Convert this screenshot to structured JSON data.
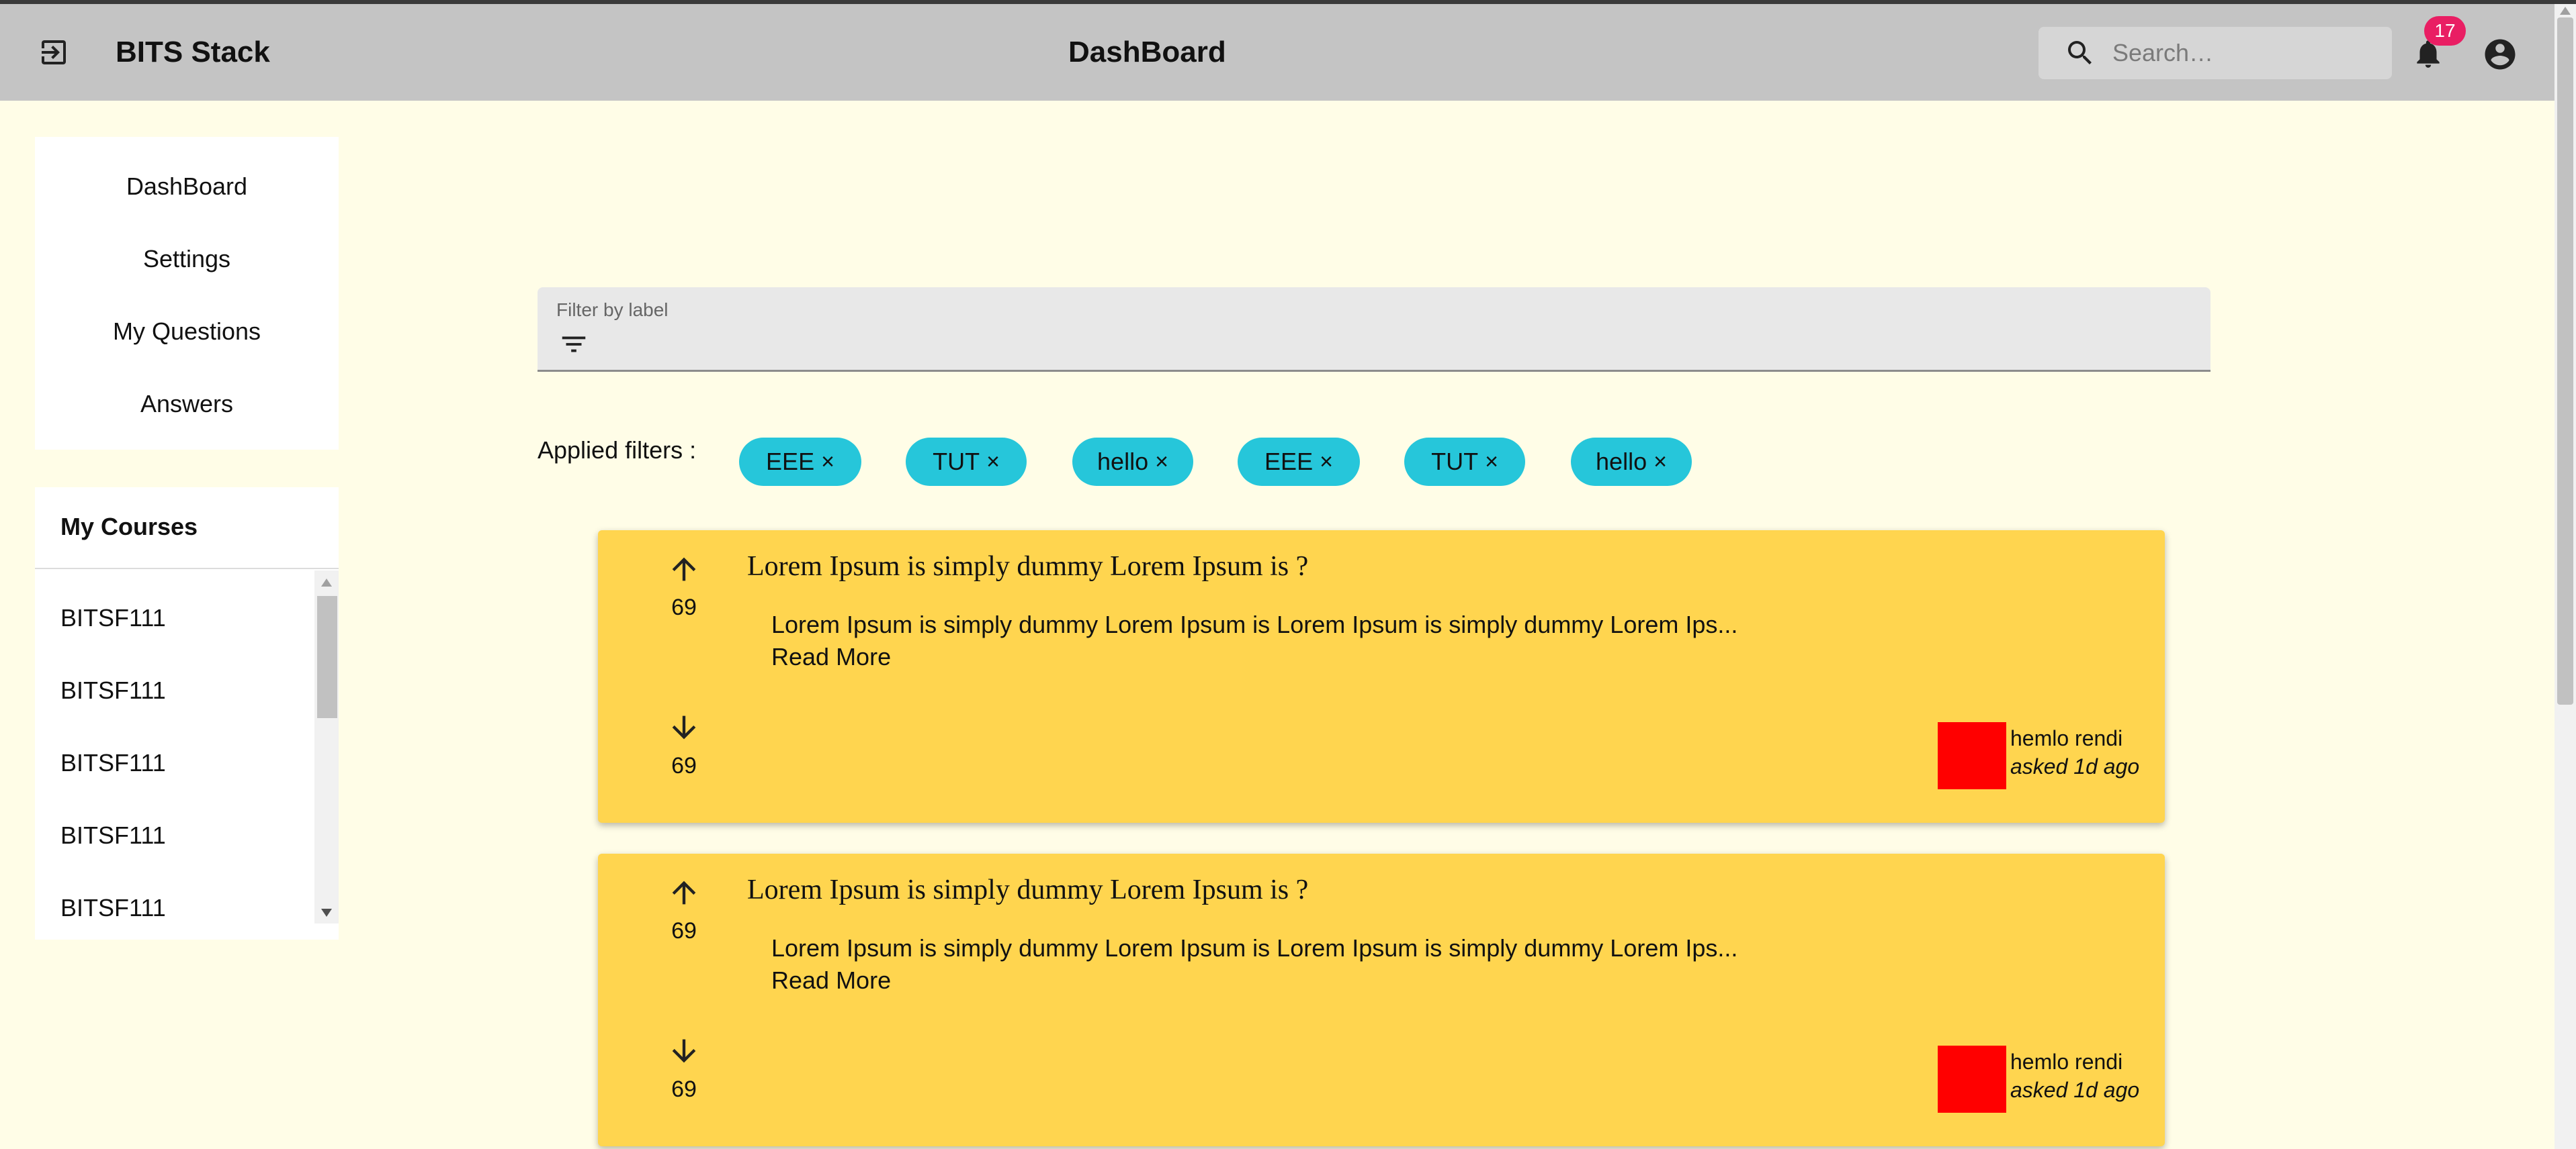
{
  "header": {
    "brand": "BITS Stack",
    "title": "DashBoard",
    "search_placeholder": "Search…",
    "notifications_count": "17"
  },
  "nav": {
    "items": [
      {
        "label": "DashBoard"
      },
      {
        "label": "Settings"
      },
      {
        "label": "My Questions"
      },
      {
        "label": "Answers"
      }
    ]
  },
  "courses": {
    "title": "My Courses",
    "items": [
      "BITSF111",
      "BITSF111",
      "BITSF111",
      "BITSF111",
      "BITSF111"
    ]
  },
  "filter": {
    "label": "Filter by label",
    "applied_label": "Applied filters :",
    "chips": [
      "EEE",
      "TUT",
      "hello",
      "EEE",
      "TUT",
      "hello"
    ],
    "chip_close": "×"
  },
  "questions": [
    {
      "title": "Lorem Ipsum is simply dummy Lorem Ipsum is ?",
      "excerpt": "Lorem Ipsum is simply dummy Lorem Ipsum is Lorem Ipsum is simply dummy Lorem Ips...",
      "read_more": "Read More",
      "upvotes": "69",
      "downvotes": "69",
      "author": "hemlo rendi",
      "asked": "asked 1d ago",
      "avatar_color": "#ff0000"
    },
    {
      "title": "Lorem Ipsum is simply dummy Lorem Ipsum is ?",
      "excerpt": "Lorem Ipsum is simply dummy Lorem Ipsum is Lorem Ipsum is simply dummy Lorem Ips...",
      "read_more": "Read More",
      "upvotes": "69",
      "downvotes": "69",
      "author": "hemlo rendi",
      "asked": "asked 1d ago",
      "avatar_color": "#ff0000"
    }
  ],
  "colors": {
    "page_bg": "#fffde7",
    "appbar_bg": "#c4c4c4",
    "chip_bg": "#26c6da",
    "card_bg": "#ffd54f",
    "badge_bg": "#e91e63"
  },
  "icons": {
    "logout": "logout-icon",
    "search": "search-icon",
    "bell": "bell-icon",
    "account": "account-circle-icon",
    "filter": "filter-list-icon",
    "upvote": "arrow-up-icon",
    "downvote": "arrow-down-icon"
  }
}
